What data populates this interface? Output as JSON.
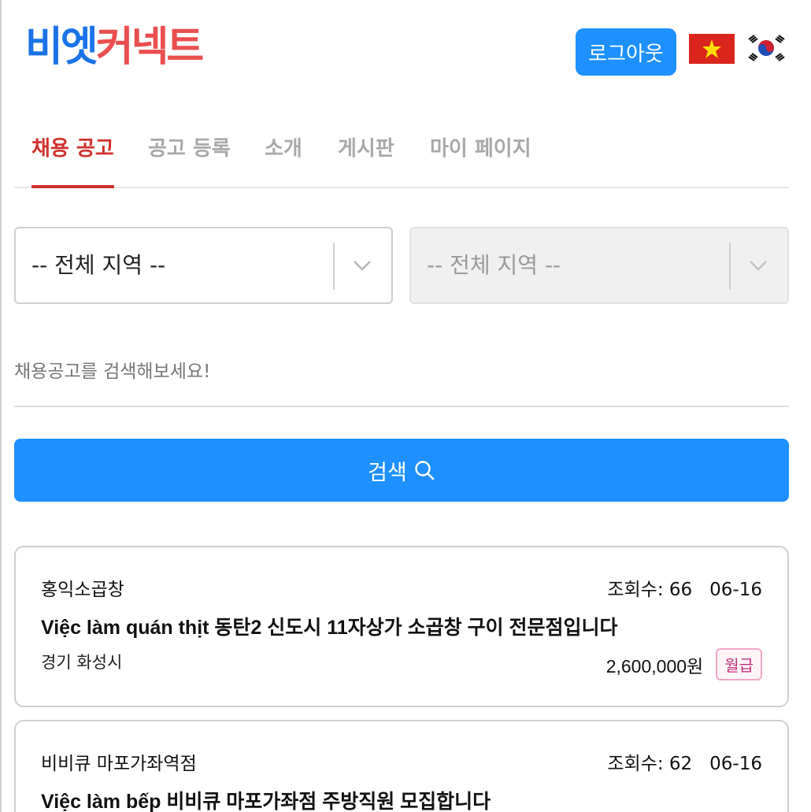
{
  "header": {
    "logo_part1": "비엣",
    "logo_part2": "커넥트",
    "logout_label": "로그아웃",
    "brand_colors": {
      "blue": "#1a73e8",
      "red": "#ea4f4f"
    }
  },
  "tabs": [
    {
      "label": "채용 공고",
      "active": true
    },
    {
      "label": "공고 등록",
      "active": false
    },
    {
      "label": "소개",
      "active": false
    },
    {
      "label": "게시판",
      "active": false
    },
    {
      "label": "마이 페이지",
      "active": false
    }
  ],
  "filters": {
    "region1": {
      "value": "-- 전체 지역 --"
    },
    "region2": {
      "value": "-- 전체 지역 --",
      "disabled": true
    }
  },
  "search": {
    "placeholder": "채용공고를 검색해보세요!",
    "button_label": "검색"
  },
  "jobs": [
    {
      "company": "홍익소곱창",
      "views_label": "조회수: 66",
      "date": "06-16",
      "title": "Việc làm quán thịt 동탄2 신도시 11자상가 소곱창 구이 전문점입니다",
      "region": "경기 화성시",
      "salary": "2,600,000원",
      "pay_type": "월급"
    },
    {
      "company": "비비큐 마포가좌역점",
      "views_label": "조회수: 62",
      "date": "06-16",
      "title": "Việc làm bếp 비비큐 마포가좌점 주방직원 모집합니다"
    }
  ],
  "colors": {
    "accent_blue": "#1e90ff",
    "tab_active": "#d0312d",
    "badge_pink": "#c0307c"
  },
  "icons": [
    "vietnam-flag-icon",
    "korea-flag-icon",
    "chevron-down-icon",
    "search-icon"
  ]
}
